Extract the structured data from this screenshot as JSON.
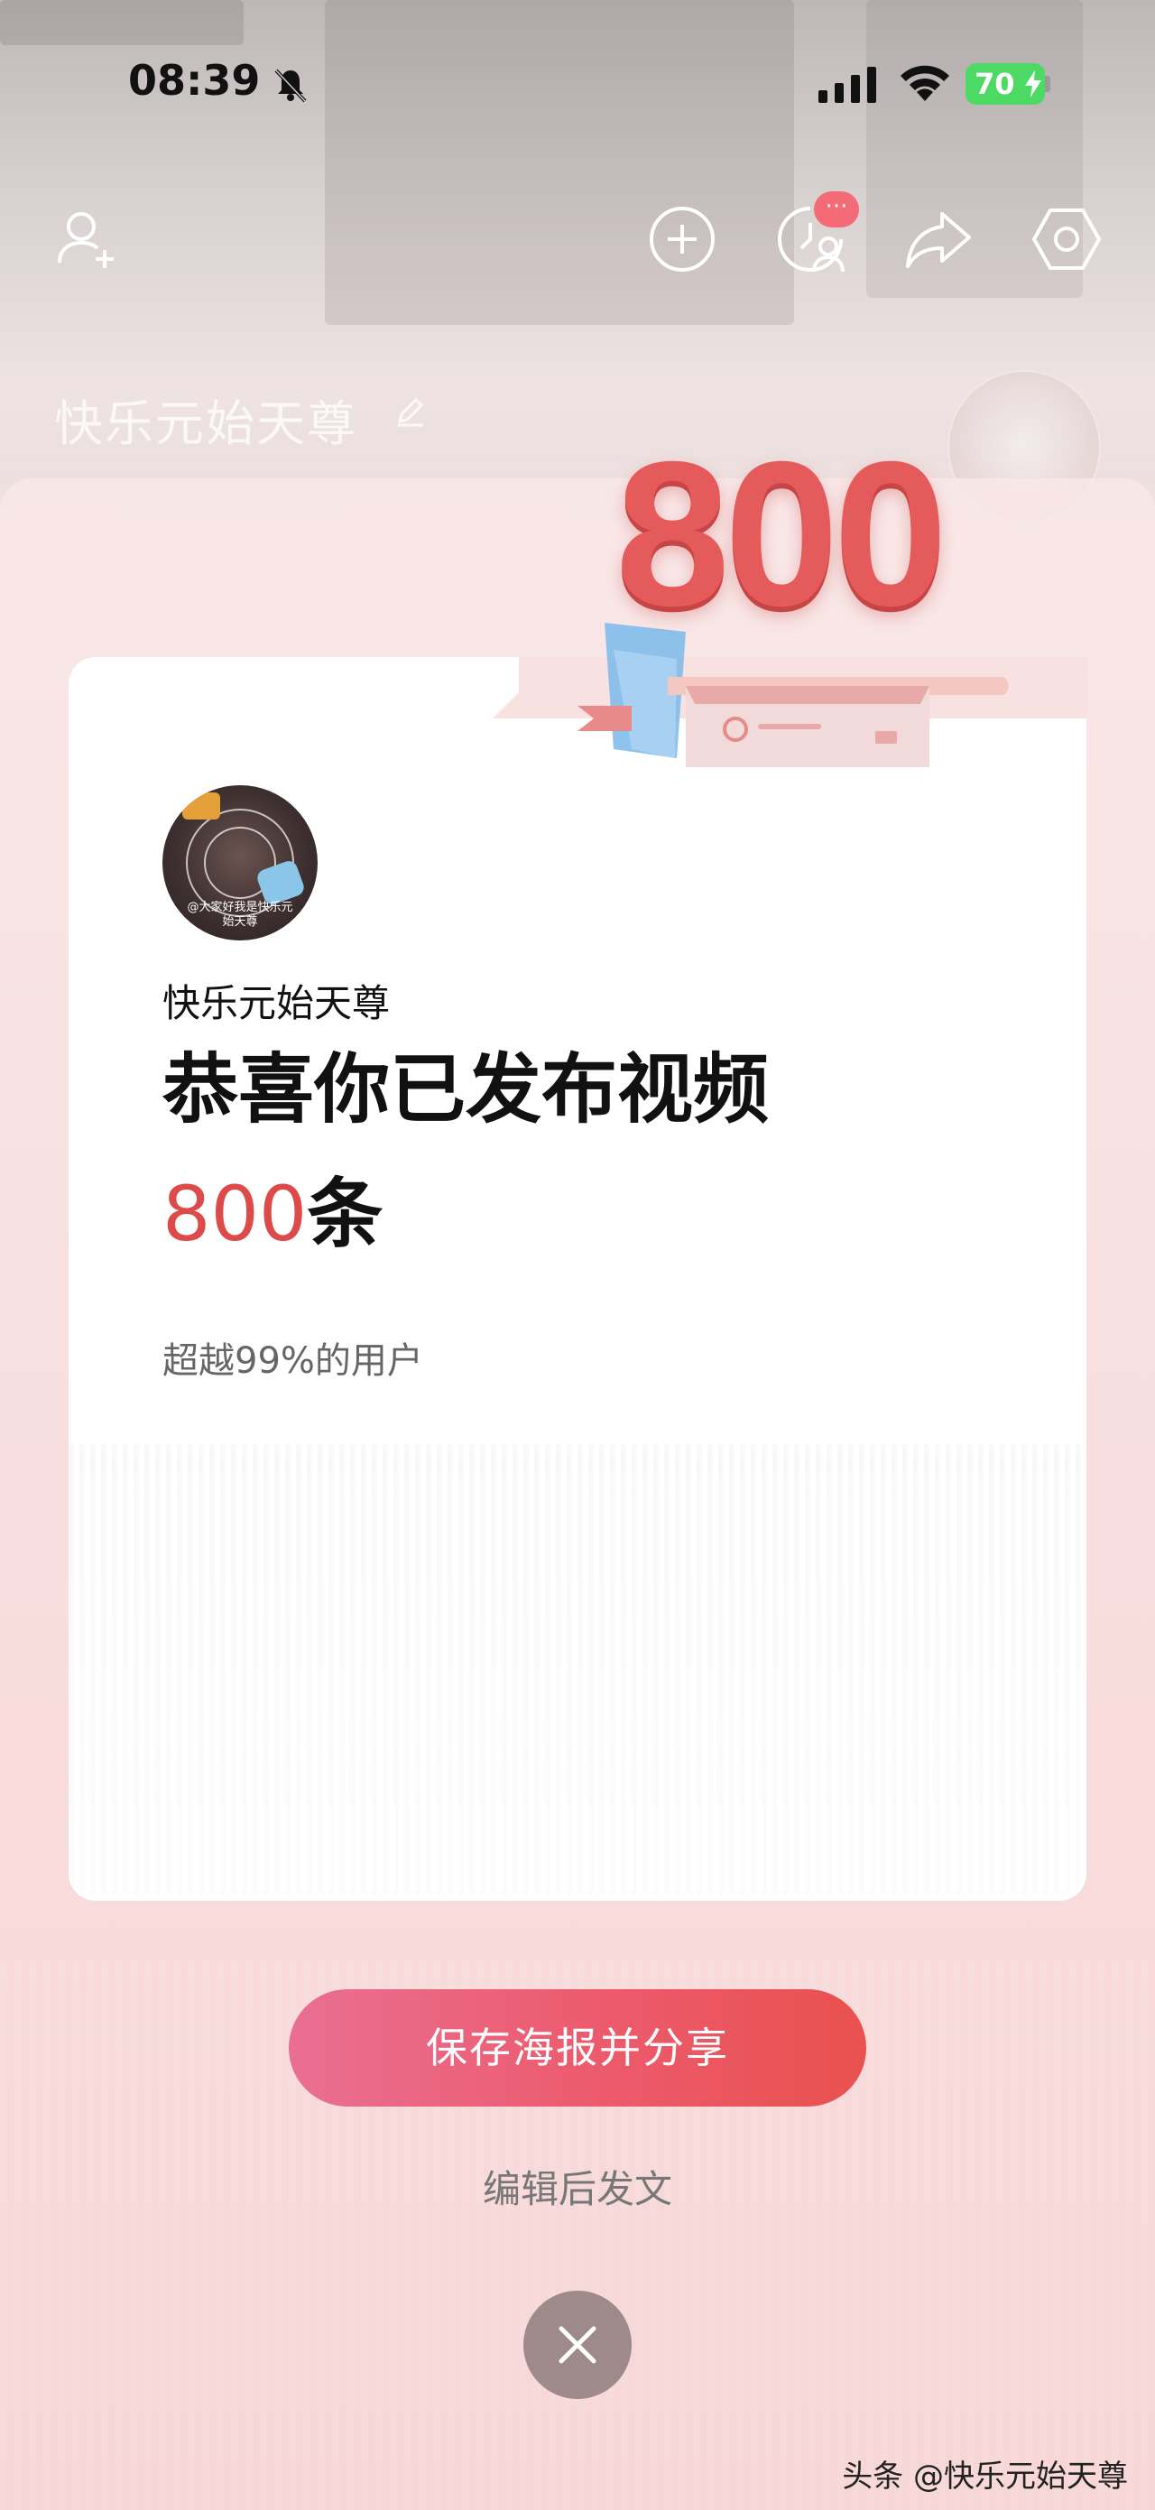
{
  "status_bar": {
    "time": "08:39",
    "battery": "70"
  },
  "top_nav": {
    "badge": "···"
  },
  "background_profile": {
    "name": "快乐元始天尊"
  },
  "milestone": {
    "number_graphic": "800",
    "avatar_caption_line1": "@大家好我是快乐元",
    "avatar_caption_line2": "始天尊"
  },
  "card": {
    "username": "快乐元始天尊",
    "headline": "恭喜你已发布视频",
    "count": "800",
    "count_unit": "条",
    "subtext": "超越99%的用户"
  },
  "actions": {
    "primary_label": "保存海报并分享",
    "secondary_label": "编辑后发文"
  },
  "watermark": "头条 @快乐元始天尊",
  "colors": {
    "accent_red": "#dc4a4a",
    "button_gradient_start": "#ea6f92",
    "button_gradient_end": "#e9514e",
    "battery_green": "#4cd964"
  }
}
